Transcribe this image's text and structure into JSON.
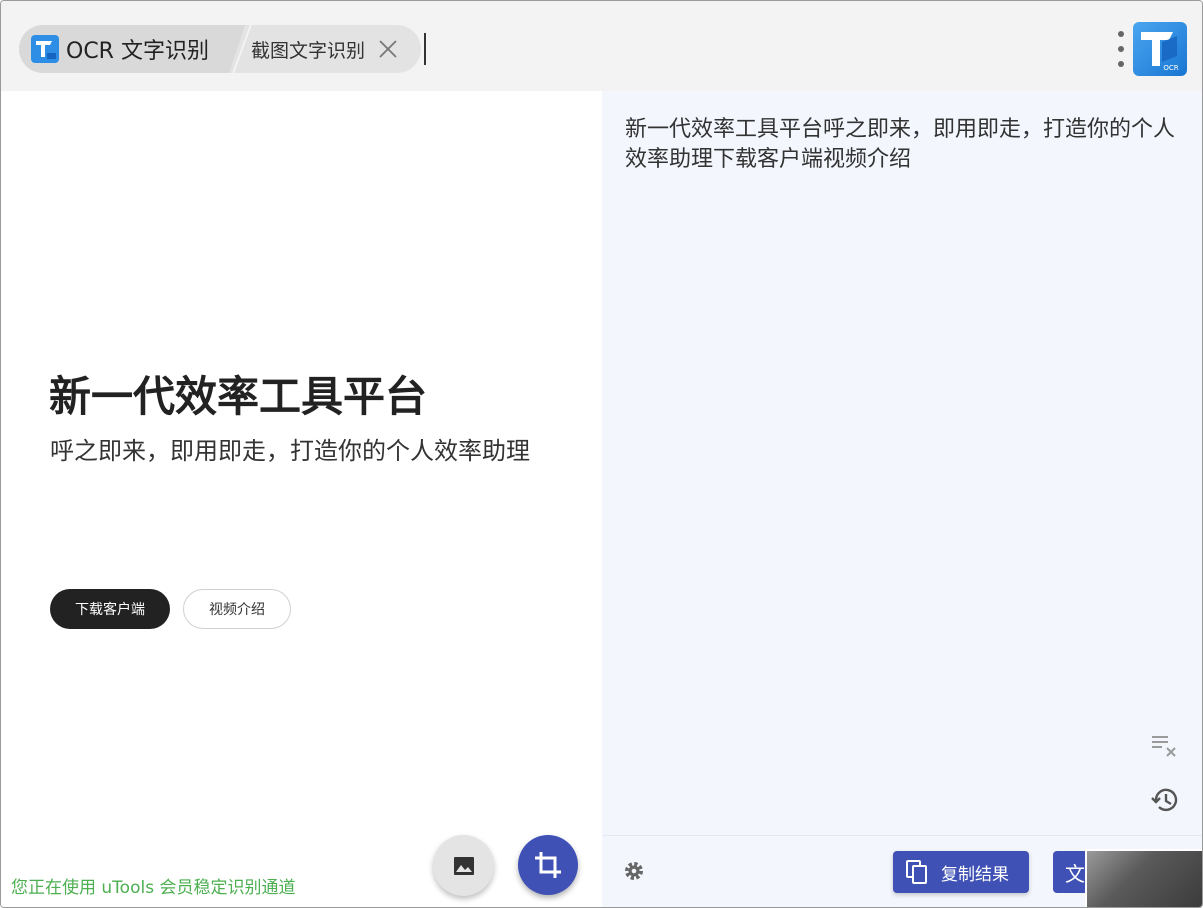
{
  "header": {
    "tabs": [
      {
        "label": "OCR 文字识别",
        "active": true
      },
      {
        "label": "截图文字识别",
        "active": false
      }
    ]
  },
  "captured_image": {
    "title": "新一代效率工具平台",
    "subtitle": "呼之即来，即用即走，打造你的个人效率助理",
    "buttons": [
      "下载客户端",
      "视频介绍"
    ]
  },
  "status": {
    "text": "您正在使用 uTools 会员稳定识别通道",
    "color": "#4caf50"
  },
  "result": {
    "text": "新一代效率工具平台呼之即来，即用即走，打造你的个人效率助理下载客户端视频介绍"
  },
  "actions": {
    "copy_label": "复制结果",
    "more_label": "文"
  },
  "colors": {
    "accent": "#3f51b5",
    "result_bg": "#f3f6fd",
    "topbar_bg": "#f3f3f3"
  }
}
